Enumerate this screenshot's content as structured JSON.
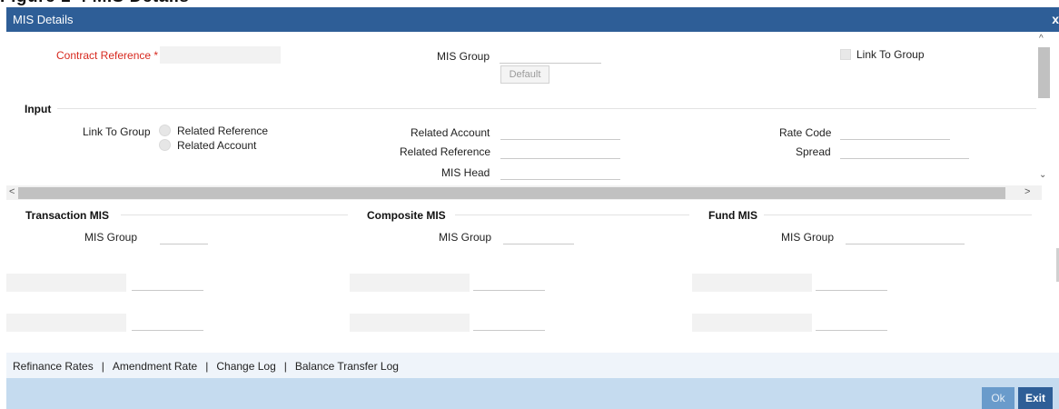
{
  "window": {
    "title": "MIS Details",
    "close_glyph": "x"
  },
  "top_section": {
    "contract_reference_label": "Contract Reference",
    "required_mark": "*",
    "mis_group_label": "MIS Group",
    "default_button": "Default",
    "link_to_group_label": "Link To Group"
  },
  "input_section": {
    "title": "Input",
    "link_to_group_label": "Link To Group",
    "radio_related_reference": "Related Reference",
    "radio_related_account": "Related Account",
    "related_account_label": "Related Account",
    "related_reference_label": "Related Reference",
    "mis_head_label": "MIS Head",
    "rate_code_label": "Rate Code",
    "spread_label": "Spread"
  },
  "mis_sections": [
    {
      "title": "Transaction MIS",
      "mis_group_label": "MIS Group"
    },
    {
      "title": "Composite MIS",
      "mis_group_label": "MIS Group"
    },
    {
      "title": "Fund MIS",
      "mis_group_label": "MIS Group"
    }
  ],
  "footer_links": [
    "Refinance Rates",
    "Amendment Rate",
    "Change Log",
    "Balance Transfer Log"
  ],
  "footer_separator": "|",
  "buttons": {
    "ok": "Ok",
    "exit": "Exit"
  },
  "icons": {
    "close": "close-icon",
    "scroll_up": "chevron-up-icon",
    "scroll_down": "chevron-down-icon",
    "scroll_left": "chevron-left-icon",
    "scroll_right": "chevron-right-icon"
  },
  "colors": {
    "title_bar": "#2e5e97",
    "required_label": "#d7281e",
    "footer_bar": "#c5dbef",
    "ok_button": "#6a9bcb",
    "exit_button": "#2e5e97"
  }
}
